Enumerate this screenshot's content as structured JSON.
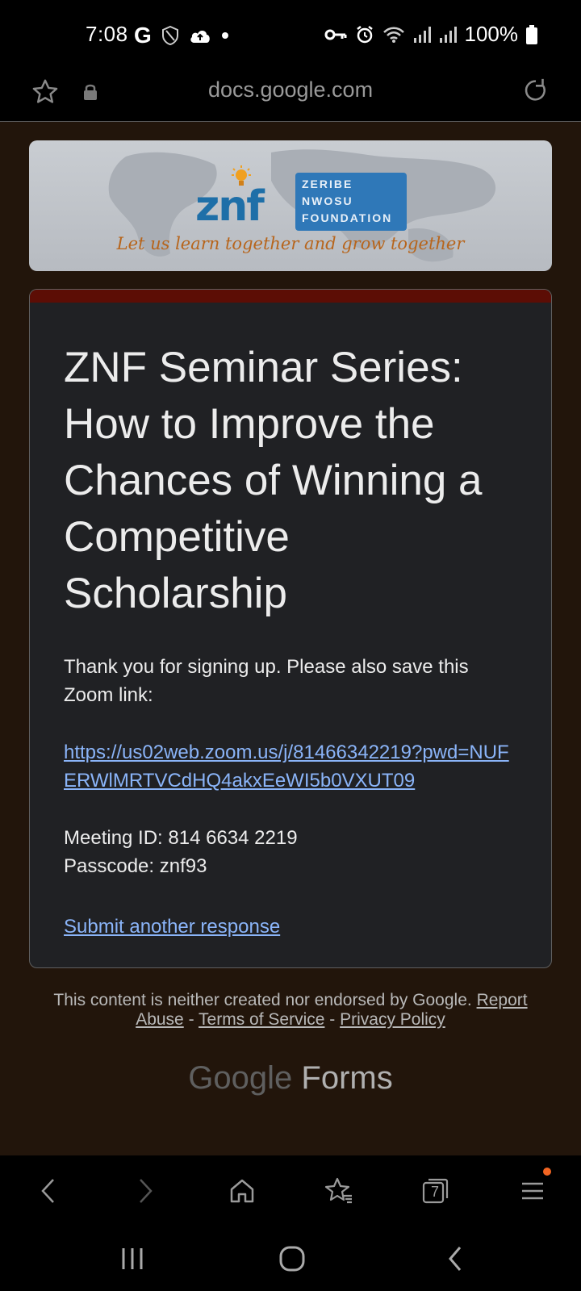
{
  "status_bar": {
    "time": "7:08",
    "battery": "100%",
    "icons": [
      "google-g-icon",
      "shield-icon",
      "cloud-upload-icon",
      "dot-icon",
      "key-icon",
      "alarm-icon",
      "wifi-icon",
      "signal-icon",
      "signal-icon",
      "battery-icon"
    ]
  },
  "address_bar": {
    "url": "docs.google.com",
    "icons": [
      "star-icon",
      "lock-icon",
      "reload-icon"
    ]
  },
  "banner": {
    "logo_mark": "znf",
    "logo_lines": [
      "ZERIBE",
      "NWOSU",
      "FOUNDATION"
    ],
    "tagline": "Let us learn together and grow together"
  },
  "form": {
    "accent_color": "#5c0d05",
    "title": "ZNF Seminar Series: How to Improve the Chances of Winning a Competitive Scholarship",
    "thanks": "Thank you for signing up. Please also save this Zoom link:",
    "zoom_link": "https://us02web.zoom.us/j/81466342219?pwd=NUFERWlMRTVCdHQ4akxEeWI5b0VXUT09",
    "meeting_id": "Meeting ID: 814 6634 2219",
    "passcode": "Passcode: znf93",
    "submit_another": "Submit another response"
  },
  "footer": {
    "disclaimer": "This content is neither created nor endorsed by Google.",
    "report_abuse": "Report Abuse",
    "sep": "-",
    "terms": "Terms of Service",
    "privacy": "Privacy Policy",
    "google": "Google",
    "forms": "Forms"
  },
  "browser_toolbar": {
    "tab_count": "7",
    "icons": [
      "back-icon",
      "forward-icon",
      "home-icon",
      "bookmarks-icon",
      "tabs-icon",
      "menu-icon"
    ],
    "notification_color": "#f26522"
  },
  "system_nav": {
    "icons": [
      "recent-apps-icon",
      "home-circle-icon",
      "back-chevron-icon"
    ]
  }
}
